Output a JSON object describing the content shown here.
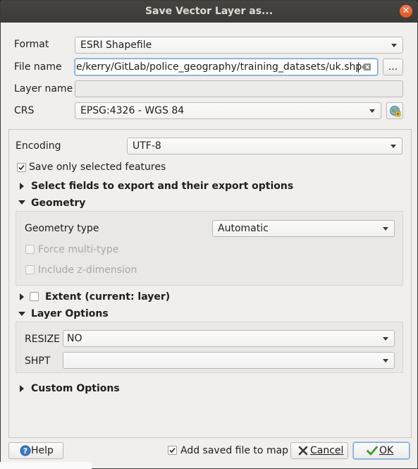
{
  "window": {
    "title": "Save Vector Layer as...",
    "close_icon": "close-icon"
  },
  "form": {
    "format_label": "Format",
    "format_value": "ESRI Shapefile",
    "filename_label": "File name",
    "filename_value": "e/kerry/GitLab/police_geography/training_datasets/uk.shp",
    "browse_label": "...",
    "layername_label": "Layer name",
    "layername_value": "",
    "crs_label": "CRS",
    "crs_value": "EPSG:4326 - WGS 84"
  },
  "panel": {
    "encoding_label": "Encoding",
    "encoding_value": "UTF-8",
    "save_selected_label": "Save only selected features",
    "save_selected_checked": true,
    "select_fields_label": "Select fields to export and their export options",
    "geometry_section_label": "Geometry",
    "geometry_type_label": "Geometry type",
    "geometry_type_value": "Automatic",
    "force_multi_label": "Force multi-type",
    "include_z_label": "Include z-dimension",
    "extent_label": "Extent (current: layer)",
    "layer_options_label": "Layer Options",
    "resize_label": "RESIZE",
    "resize_value": "NO",
    "shpt_label": "SHPT",
    "shpt_value": "",
    "custom_options_label": "Custom Options"
  },
  "footer": {
    "help_label": "Help",
    "add_saved_label": "Add saved file to map",
    "add_saved_checked": true,
    "cancel_label": "Cancel",
    "ok_label": "OK"
  },
  "colors": {
    "titlebar": "#3c3b37",
    "close": "#e35320",
    "window_bg": "#f0efee"
  }
}
